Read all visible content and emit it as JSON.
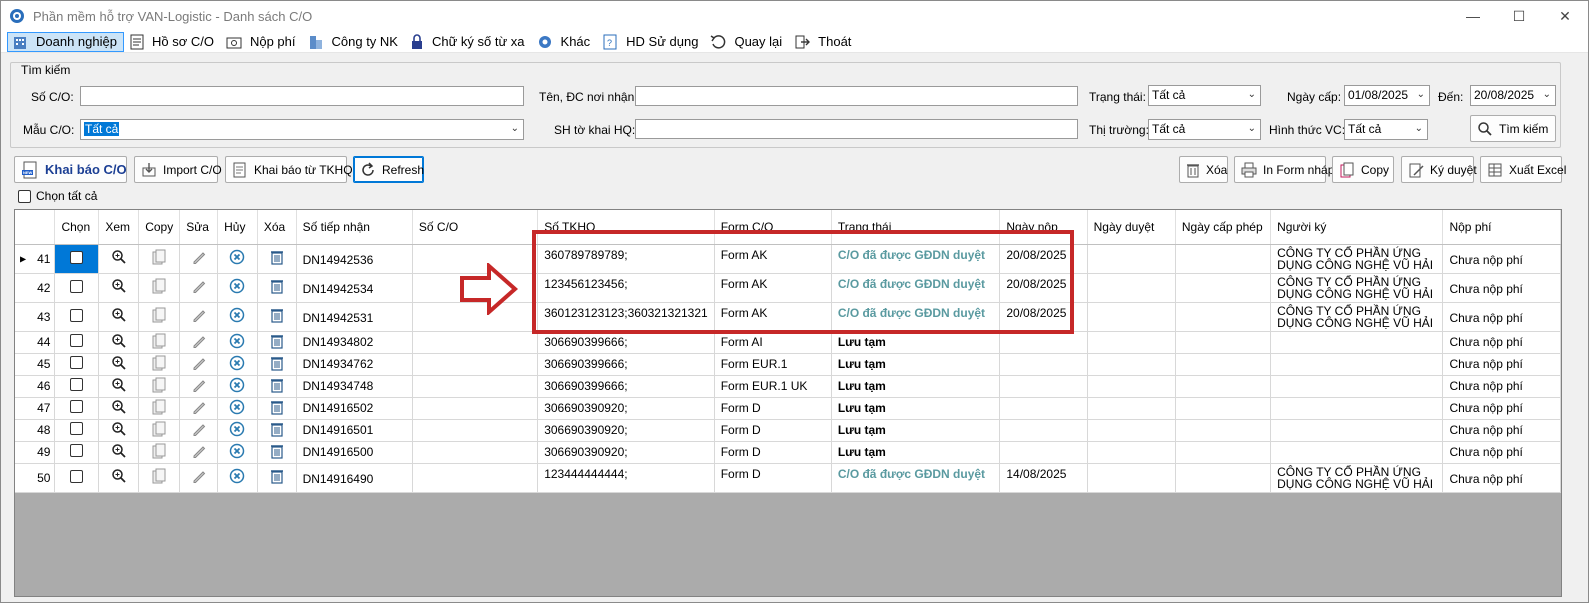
{
  "window": {
    "title": "Phần mềm hỗ trợ VAN-Logistic - Danh sách C/O"
  },
  "menu": [
    {
      "label": "Doanh nghiệp",
      "icon": "building-icon",
      "active": true
    },
    {
      "label": "Hồ sơ C/O",
      "icon": "document-icon"
    },
    {
      "label": "Nộp phí",
      "icon": "payment-icon"
    },
    {
      "label": "Công ty NK",
      "icon": "company-icon"
    },
    {
      "label": "Chữ ký số từ xa",
      "icon": "lock-icon"
    },
    {
      "label": "Khác",
      "icon": "gear-icon"
    },
    {
      "label": "HD Sử dụng",
      "icon": "help-icon"
    },
    {
      "label": "Quay lại",
      "icon": "back-icon"
    },
    {
      "label": "Thoát",
      "icon": "exit-icon"
    }
  ],
  "search": {
    "group_label": "Tìm kiếm",
    "so_co_label": "Số C/O:",
    "so_co_value": "",
    "ten_label": "Tên, ĐC nơi nhận:",
    "ten_value": "",
    "trang_thai_label": "Trạng thái:",
    "trang_thai_value": "Tất cả",
    "ngay_cap_label": "Ngày cấp:",
    "ngay_cap_value": "01/08/2025",
    "den_label": "Đến:",
    "den_value": "20/08/2025",
    "mau_co_label": "Mẫu C/O:",
    "mau_co_value": "Tất cả",
    "sh_label": "SH tờ khai HQ:",
    "sh_value": "",
    "thi_truong_label": "Thị trường:",
    "thi_truong_value": "Tất cả",
    "hinh_thuc_label": "Hình thức VC:",
    "hinh_thuc_value": "Tất cả",
    "search_button": "Tìm kiếm"
  },
  "toolbar": {
    "khai_bao": "Khai báo C/O",
    "import": "Import C/O",
    "khai_bao_tkhq": "Khai báo từ TKHQ",
    "refresh": "Refresh",
    "xoa": "Xóa",
    "in_form": "In Form nháp",
    "copy": "Copy",
    "ky_duyet": "Ký duyệt",
    "xuat_excel": "Xuất Excel",
    "chon_tat_ca": "Chọn tất cả"
  },
  "table": {
    "headers": [
      "Chọn",
      "Xem",
      "Copy",
      "Sửa",
      "Hủy",
      "Xóa",
      "Số tiếp nhận",
      "Số C/O",
      "Số TKHQ",
      "Form C/O",
      "Trạng thái",
      "Ngày nộp",
      "Ngày duyệt",
      "Ngày cấp phép",
      "Người ký",
      "Nộp phí"
    ],
    "rows": [
      {
        "no": "41",
        "so_tiep_nhan": "DN14942536",
        "so_co": "",
        "so_tkhq": "360789789789;",
        "form": "Form AK",
        "status": "C/O đã được GĐDN duyệt",
        "status_type": "approved",
        "ngay_nop": "20/08/2025",
        "ngay_duyet": "",
        "ngay_cap": "",
        "nguoi_ky": "CÔNG TY CỔ PHẦN ỨNG DỤNG CÔNG NGHỆ VŨ HẢI",
        "nop_phi": "Chưa nộp phí"
      },
      {
        "no": "42",
        "so_tiep_nhan": "DN14942534",
        "so_co": "",
        "so_tkhq": "123456123456;",
        "form": "Form AK",
        "status": "C/O đã được GĐDN duyệt",
        "status_type": "approved",
        "ngay_nop": "20/08/2025",
        "ngay_duyet": "",
        "ngay_cap": "",
        "nguoi_ky": "CÔNG TY CỔ PHẦN ỨNG DỤNG CÔNG NGHỆ VŨ HẢI",
        "nop_phi": "Chưa nộp phí"
      },
      {
        "no": "43",
        "so_tiep_nhan": "DN14942531",
        "so_co": "",
        "so_tkhq": "360123123123;360321321321",
        "form": "Form AK",
        "status": "C/O đã được GĐDN duyệt",
        "status_type": "approved",
        "ngay_nop": "20/08/2025",
        "ngay_duyet": "",
        "ngay_cap": "",
        "nguoi_ky": "CÔNG TY CỔ PHẦN ỨNG DỤNG CÔNG NGHỆ VŨ HẢI",
        "nop_phi": "Chưa nộp phí"
      },
      {
        "no": "44",
        "so_tiep_nhan": "DN14934802",
        "so_co": "",
        "so_tkhq": "306690399666;",
        "form": "Form AI",
        "status": "Lưu tạm",
        "status_type": "draft",
        "ngay_nop": "",
        "ngay_duyet": "",
        "ngay_cap": "",
        "nguoi_ky": "",
        "nop_phi": "Chưa nộp phí"
      },
      {
        "no": "45",
        "so_tiep_nhan": "DN14934762",
        "so_co": "",
        "so_tkhq": "306690399666;",
        "form": "Form EUR.1",
        "status": "Lưu tạm",
        "status_type": "draft",
        "ngay_nop": "",
        "ngay_duyet": "",
        "ngay_cap": "",
        "nguoi_ky": "",
        "nop_phi": "Chưa nộp phí"
      },
      {
        "no": "46",
        "so_tiep_nhan": "DN14934748",
        "so_co": "",
        "so_tkhq": "306690399666;",
        "form": "Form EUR.1 UK",
        "status": "Lưu tạm",
        "status_type": "draft",
        "ngay_nop": "",
        "ngay_duyet": "",
        "ngay_cap": "",
        "nguoi_ky": "",
        "nop_phi": "Chưa nộp phí"
      },
      {
        "no": "47",
        "so_tiep_nhan": "DN14916502",
        "so_co": "",
        "so_tkhq": "306690390920;",
        "form": "Form D",
        "status": "Lưu tạm",
        "status_type": "draft",
        "ngay_nop": "",
        "ngay_duyet": "",
        "ngay_cap": "",
        "nguoi_ky": "",
        "nop_phi": "Chưa nộp phí"
      },
      {
        "no": "48",
        "so_tiep_nhan": "DN14916501",
        "so_co": "",
        "so_tkhq": "306690390920;",
        "form": "Form D",
        "status": "Lưu tạm",
        "status_type": "draft",
        "ngay_nop": "",
        "ngay_duyet": "",
        "ngay_cap": "",
        "nguoi_ky": "",
        "nop_phi": "Chưa nộp phí"
      },
      {
        "no": "49",
        "so_tiep_nhan": "DN14916500",
        "so_co": "",
        "so_tkhq": "306690390920;",
        "form": "Form D",
        "status": "Lưu tạm",
        "status_type": "draft",
        "ngay_nop": "",
        "ngay_duyet": "",
        "ngay_cap": "",
        "nguoi_ky": "",
        "nop_phi": "Chưa nộp phí"
      },
      {
        "no": "50",
        "so_tiep_nhan": "DN14916490",
        "so_co": "",
        "so_tkhq": "123444444444;",
        "form": "Form D",
        "status": "C/O đã được GĐDN duyệt",
        "status_type": "approved",
        "ngay_nop": "14/08/2025",
        "ngay_duyet": "",
        "ngay_cap": "",
        "nguoi_ky": "CÔNG TY CỔ PHẦN ỨNG DỤNG CÔNG NGHỆ VŨ HẢI",
        "nop_phi": "Chưa nộp phí"
      }
    ]
  },
  "colors": {
    "accent": "#0078d7",
    "approved": "#5a9aa0",
    "annotation": "#c62828"
  }
}
